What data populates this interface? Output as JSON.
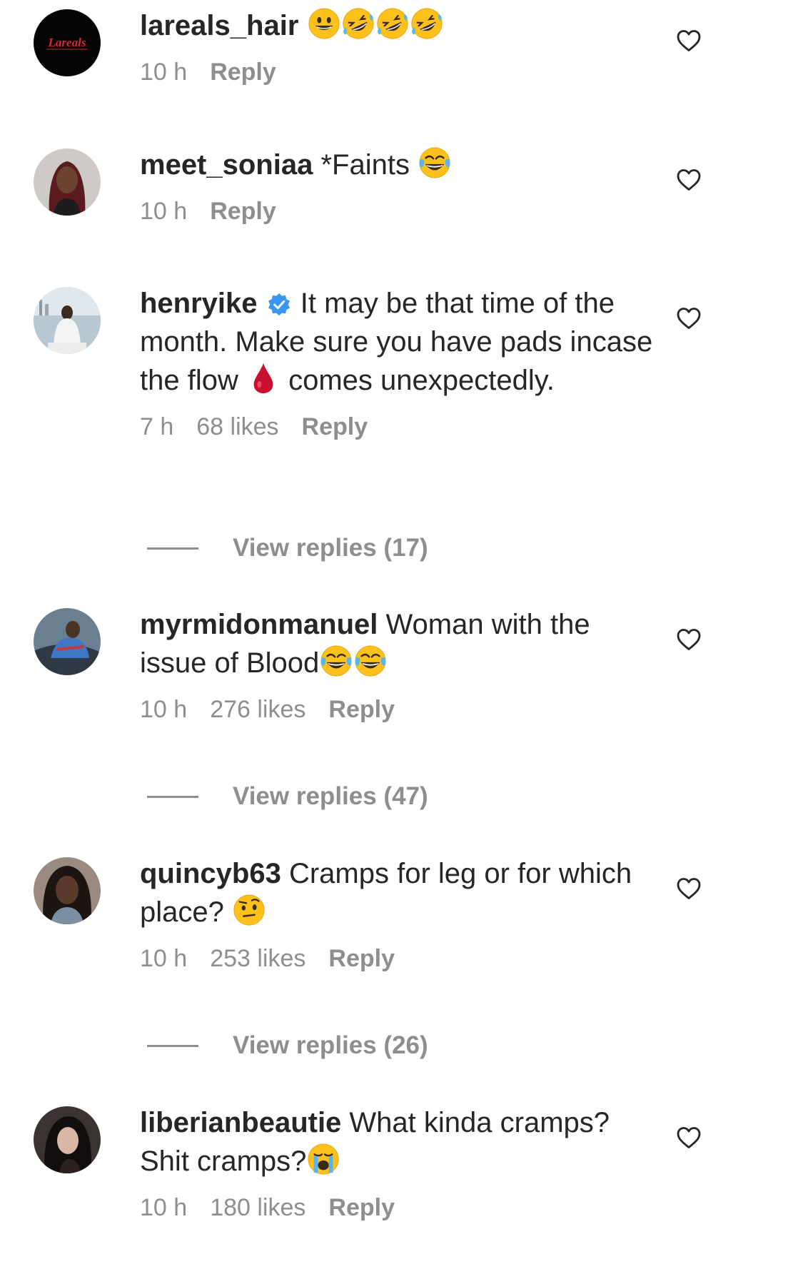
{
  "comments": [
    {
      "username": "lareals_hair",
      "text": "",
      "time": "10 h",
      "likes": "",
      "reply_label": "Reply",
      "logo_text": "Lareals"
    },
    {
      "username": "meet_soniaa",
      "text": " *Faints ",
      "time": "10 h",
      "likes": "",
      "reply_label": "Reply"
    },
    {
      "username": "henryike",
      "text_a": "It may be that time of the month. Make sure you have pads incase the flow ",
      "text_b": " comes unexpectedly.",
      "time": "7 h",
      "likes": "68 likes",
      "reply_label": "Reply",
      "view_replies": "View replies (17)"
    },
    {
      "username": "myrmidonmanuel",
      "text": " Woman with the issue of Blood",
      "time": "10 h",
      "likes": "276 likes",
      "reply_label": "Reply",
      "view_replies": "View replies (47)"
    },
    {
      "username": "quincyb63",
      "text": " Cramps for leg or for which place? ",
      "time": "10 h",
      "likes": "253 likes",
      "reply_label": "Reply",
      "view_replies": "View replies (26)"
    },
    {
      "username": "liberianbeautie",
      "text": " What kinda cramps? Shit cramps?",
      "time": "10 h",
      "likes": "180 likes",
      "reply_label": "Reply"
    }
  ],
  "icons": [
    "heart-outline-icon",
    "verified-badge-icon",
    "grinning-face-emoji",
    "rolling-on-floor-laughing-emoji",
    "tears-of-joy-emoji",
    "drop-of-blood-emoji",
    "raised-eyebrow-emoji",
    "loudly-crying-emoji"
  ],
  "colors": {
    "text": "#262626",
    "secondary": "#8e8e8e",
    "verified": "#3897f0",
    "background": "#ffffff"
  }
}
